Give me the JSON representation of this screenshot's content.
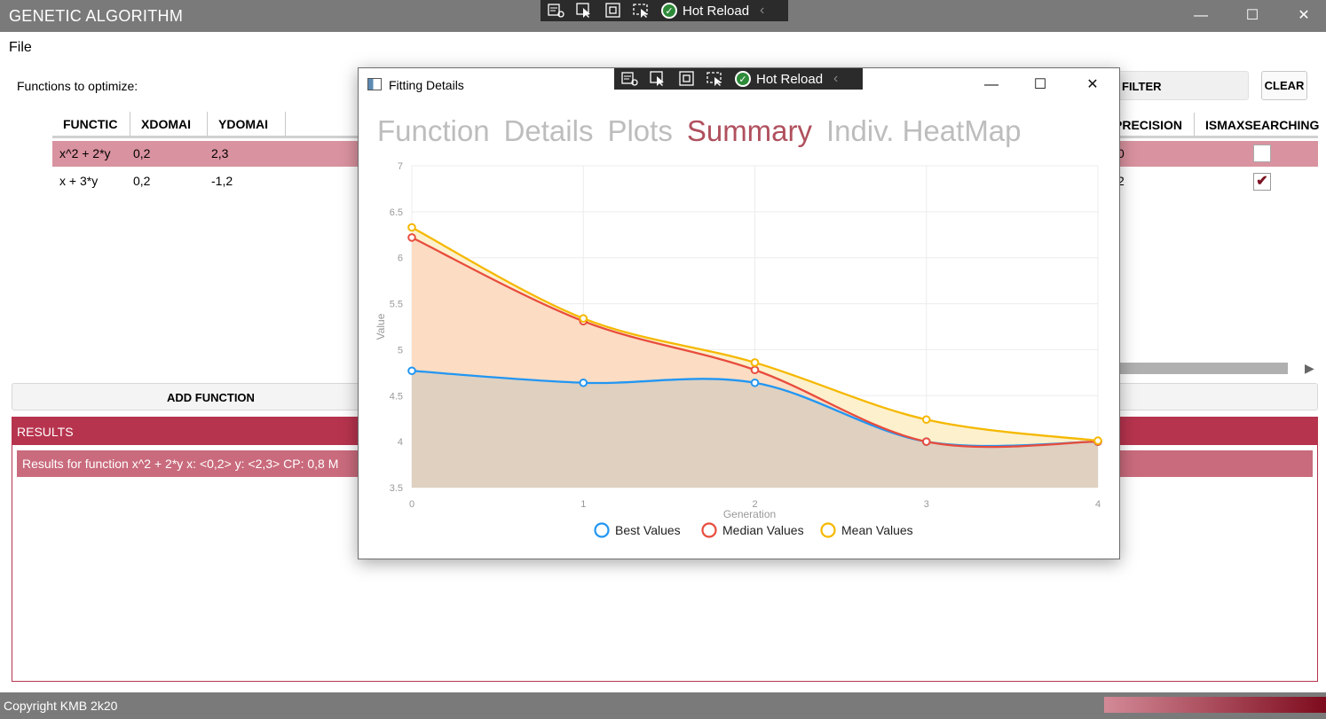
{
  "app": {
    "title": "GENETIC ALGORITHM"
  },
  "window_controls": {
    "minimize": "—",
    "maximize": "☐",
    "close": "✕"
  },
  "hot_reload": {
    "label": "Hot Reload",
    "collapse": "‹"
  },
  "menu": {
    "file": "File"
  },
  "functions_label": "Functions to optimize:",
  "grid": {
    "columns": [
      "FUNCTIC",
      "XDOMAI",
      "YDOMAI"
    ],
    "right_columns": {
      "precision": "PRECISION",
      "ismaxsearching": "ISMAXSEARCHING"
    },
    "rows": [
      {
        "function": "x^2 + 2*y",
        "xdomain": "0,2",
        "ydomain": "2,3",
        "precision_partial": "0",
        "ismaxsearching": false
      },
      {
        "function": "x + 3*y",
        "xdomain": "0,2",
        "ydomain": "-1,2",
        "precision_partial": "2",
        "ismaxsearching": true
      }
    ]
  },
  "filter": {
    "label": "FILTER"
  },
  "clear": {
    "label": "CLEAR"
  },
  "add_function": {
    "label": "ADD FUNCTION"
  },
  "results": {
    "header": "RESULTS",
    "items": [
      "Results for function  x^2 + 2*y x: <0,2> y: <2,3> CP: 0,8 M"
    ]
  },
  "status": {
    "copyright": "Copyright KMB 2k20"
  },
  "dialog": {
    "title": "Fitting Details",
    "tabs": [
      "Function",
      "Details",
      "Plots",
      "Summary",
      "Indiv. HeatMap"
    ],
    "active_tab": "Summary"
  },
  "chart_data": {
    "type": "line",
    "xlabel": "Generation",
    "ylabel": "Value",
    "x": [
      0,
      1,
      2,
      3,
      4
    ],
    "xlim": [
      0,
      4
    ],
    "ylim": [
      3.5,
      7
    ],
    "y_ticks": [
      3.5,
      4,
      4.5,
      5,
      5.5,
      6,
      6.5,
      7
    ],
    "grid": true,
    "legend_position": "bottom",
    "series": [
      {
        "name": "Best Values",
        "values": [
          4.77,
          4.64,
          4.64,
          4.0,
          4.0
        ],
        "color": "#2196f3",
        "fill": "#dfd0c0"
      },
      {
        "name": "Median Values",
        "values": [
          6.22,
          5.31,
          4.78,
          4.0,
          4.0
        ],
        "color": "#e84c3d",
        "fill": "#fcdcc2"
      },
      {
        "name": "Mean Values",
        "values": [
          6.33,
          5.34,
          4.86,
          4.24,
          4.01
        ],
        "color": "#f5b800",
        "fill": "#fdf0cc"
      }
    ]
  }
}
